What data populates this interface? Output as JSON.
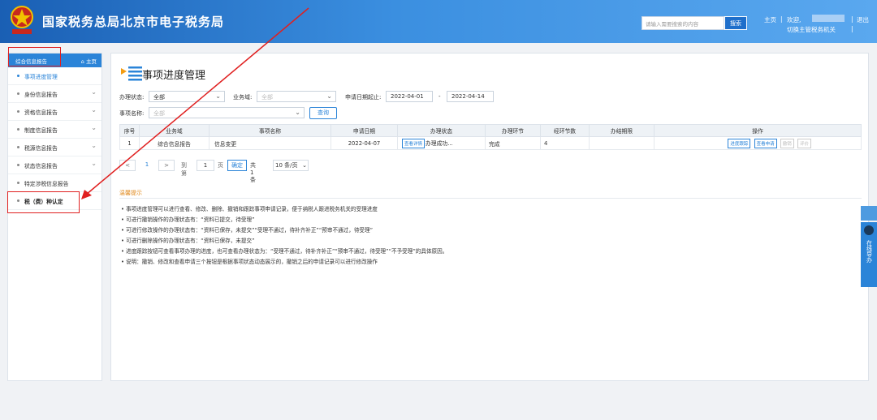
{
  "header": {
    "title": "国家税务总局北京市电子税务局",
    "search_placeholder": "请输入需要搜索的内容",
    "search_button": "搜索",
    "home_link": "主页",
    "welcome": "欢迎,",
    "switch_org": "切换主管税务机关",
    "logout": "退出"
  },
  "sidebar": {
    "section_title": "综合信息报告",
    "home_label": "主页",
    "items": [
      {
        "label": "事项进度管理",
        "active": true,
        "expandable": false
      },
      {
        "label": "身份信息报告",
        "expandable": true
      },
      {
        "label": "资格信息报告",
        "expandable": true
      },
      {
        "label": "制度信息报告",
        "expandable": true
      },
      {
        "label": "税源信息报告",
        "expandable": true
      },
      {
        "label": "状态信息报告",
        "expandable": true
      },
      {
        "label": "特定涉税信息报告",
        "expandable": false
      },
      {
        "label": "税（费）种认定",
        "expandable": false
      }
    ]
  },
  "page": {
    "title": "事项进度管理"
  },
  "filters": {
    "status_label": "办理状态:",
    "status_value": "全部",
    "domain_label": "业务域:",
    "domain_value": "全部",
    "date_label": "申请日期起止:",
    "date_from": "2022-04-01",
    "date_sep": "-",
    "date_to": "2022-04-14",
    "item_label": "事项名称:",
    "item_value": "全部",
    "query_button": "查询"
  },
  "table": {
    "headers": [
      "序号",
      "业务域",
      "事项名称",
      "申请日期",
      "办理状态",
      "办理环节",
      "经环节数",
      "办结期限",
      "操作"
    ],
    "rows": [
      {
        "index": "1",
        "domain": "综合信息报告",
        "item": "信息变更",
        "date": "2022-04-07",
        "detail_button": "查看详情",
        "status": "办理成功...",
        "stage": "完成",
        "steps": "4",
        "deadline": "",
        "actions": [
          "进度跟踪",
          "查看申请",
          "撤销",
          "评价"
        ]
      }
    ]
  },
  "pager": {
    "prev": "<",
    "current": "1",
    "next": ">",
    "goto_label": "到第",
    "goto_value": "1",
    "page_unit": "页",
    "confirm": "确定",
    "total": "共 1 条",
    "per_page": "10 条/页"
  },
  "tips": {
    "title": "温馨提示",
    "lines": [
      "事项进度管理可以进行查看、修改、删除、撤销和跟踪事项申请记录，便于纳税人跟进税务机关的受理进度",
      "可进行撤销操作的办理状态有：“资料已提交，待受理”",
      "可进行修改操作的办理状态有：“资料已保存，未提交”“受理不通过，待补齐补正”“预审不通过，待受理”",
      "可进行删除操作的办理状态有：“资料已保存，未提交”",
      "进度跟踪按钮可查看事项办理的进度，也可查看办理状态为：“受理不通过，待补齐补正”“预审不通过，待受理”“不予受理”的具体原因。",
      "说明：撤销、修改和查看申请三个按钮是根据事项状态动态展示的，撤销之后的申请记录可以进行修改操作"
    ]
  },
  "float_widget": {
    "label": "在线导办"
  },
  "colors": {
    "brand_blue": "#2b84d8",
    "header_dark": "#1a5fb4",
    "annotation_red": "#e02020",
    "tip_orange": "#e08a1e"
  }
}
